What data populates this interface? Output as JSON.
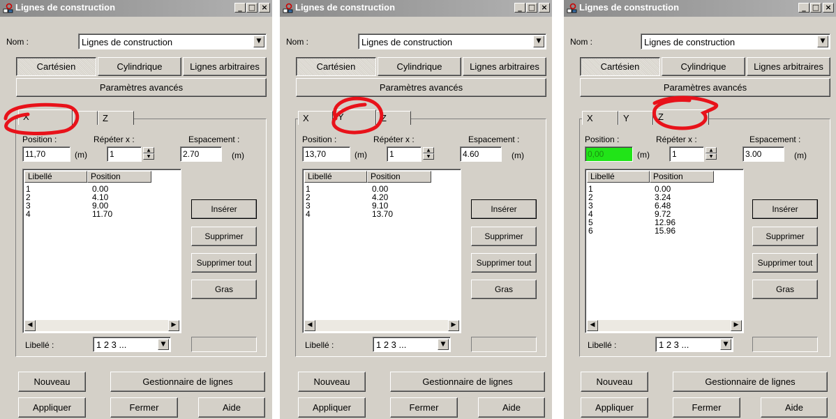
{
  "colors": {
    "annotation": "#e8121a",
    "highlight_field": "#21e418",
    "window_bg": "#d4d0c8"
  },
  "windows": [
    {
      "title": "Lignes de construction",
      "nom_label": "Nom :",
      "nom_value": "Lignes de construction",
      "modes": [
        "Cartésien",
        "Cylindrique",
        "Lignes arbitraires"
      ],
      "active_mode": 0,
      "advanced_label": "Paramètres avancés",
      "tabs": [
        "X",
        "",
        "Z"
      ],
      "active_tab": 0,
      "position_label": "Position :",
      "repeat_label": "Répéter x :",
      "spacing_label": "Espacement :",
      "position_value": "11,70",
      "unit": "(m)",
      "repeat_value": "1",
      "spacing_value": "2.70",
      "columns": [
        "Libellé",
        "Position"
      ],
      "rows": [
        [
          "1",
          "0.00"
        ],
        [
          "2",
          "4.10"
        ],
        [
          "3",
          "9.00"
        ],
        [
          "4",
          "11.70"
        ]
      ],
      "side_buttons": [
        "Insérer",
        "Supprimer",
        "Supprimer tout",
        "Gras"
      ],
      "libelle_label": "Libellé :",
      "libelle_value": "1 2 3 ...",
      "bottom_buttons": {
        "new": "Nouveau",
        "manager": "Gestionnaire de lignes",
        "apply": "Appliquer",
        "close": "Fermer",
        "help": "Aide"
      }
    },
    {
      "title": "Lignes de construction",
      "nom_label": "Nom :",
      "nom_value": "Lignes de construction",
      "modes": [
        "Cartésien",
        "Cylindrique",
        "Lignes arbitraires"
      ],
      "active_mode": 0,
      "advanced_label": "Paramètres avancés",
      "tabs": [
        "X",
        "Y",
        "Z"
      ],
      "active_tab": 1,
      "position_label": "Position :",
      "repeat_label": "Répéter x :",
      "spacing_label": "Espacement :",
      "position_value": "13,70",
      "unit": "(m)",
      "repeat_value": "1",
      "spacing_value": "4.60",
      "columns": [
        "Libellé",
        "Position"
      ],
      "rows": [
        [
          "1",
          "0.00"
        ],
        [
          "2",
          "4.20"
        ],
        [
          "3",
          "9.10"
        ],
        [
          "4",
          "13.70"
        ]
      ],
      "side_buttons": [
        "Insérer",
        "Supprimer",
        "Supprimer tout",
        "Gras"
      ],
      "libelle_label": "Libellé :",
      "libelle_value": "1 2 3 ...",
      "bottom_buttons": {
        "new": "Nouveau",
        "manager": "Gestionnaire de lignes",
        "apply": "Appliquer",
        "close": "Fermer",
        "help": "Aide"
      }
    },
    {
      "title": "Lignes de construction",
      "nom_label": "Nom :",
      "nom_value": "Lignes de construction",
      "modes": [
        "Cartésien",
        "Cylindrique",
        "Lignes arbitraires"
      ],
      "active_mode": 0,
      "advanced_label": "Paramètres avancés",
      "tabs": [
        "X",
        "Y",
        "Z"
      ],
      "active_tab": 2,
      "position_label": "Position :",
      "repeat_label": "Répéter x :",
      "spacing_label": "Espacement :",
      "position_value": "0,00",
      "unit": "(m)",
      "repeat_value": "1",
      "spacing_value": "3.00",
      "columns": [
        "Libellé",
        "Position"
      ],
      "rows": [
        [
          "1",
          "0.00"
        ],
        [
          "2",
          "3.24"
        ],
        [
          "3",
          "6.48"
        ],
        [
          "4",
          "9.72"
        ],
        [
          "5",
          "12.96"
        ],
        [
          "6",
          "15.96"
        ]
      ],
      "side_buttons": [
        "Insérer",
        "Supprimer",
        "Supprimer tout",
        "Gras"
      ],
      "libelle_label": "Libellé :",
      "libelle_value": "1 2 3 ...",
      "bottom_buttons": {
        "new": "Nouveau",
        "manager": "Gestionnaire de lignes",
        "apply": "Appliquer",
        "close": "Fermer",
        "help": "Aide"
      }
    }
  ]
}
